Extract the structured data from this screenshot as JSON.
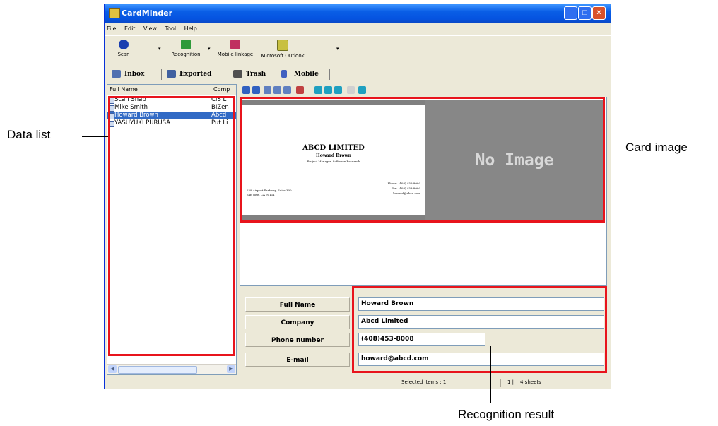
{
  "window": {
    "title": "CardMinder"
  },
  "menu": [
    "File",
    "Edit",
    "View",
    "Tool",
    "Help"
  ],
  "toolbar": {
    "scan": "Scan",
    "recognition": "Recognition",
    "mobile_linkage": "Mobile linkage",
    "outlook": "Microsoft Outlook"
  },
  "tabs": [
    "Inbox",
    "Exported",
    "Trash",
    "Mobile"
  ],
  "list": {
    "col_name": "Full Name",
    "col_company": "Comp",
    "rows": [
      {
        "name": "Scan Snap",
        "company": "CIS L"
      },
      {
        "name": "Mike Smith",
        "company": "BIZen"
      },
      {
        "name": "Howard Brown",
        "company": "Abcd"
      },
      {
        "name": "YASUYUKI PURUSA",
        "company": "Put Li"
      }
    ]
  },
  "card": {
    "company": "ABCD LIMITED",
    "name": "Howard Brown",
    "title": "Project Manager, Software Research",
    "address1": "228 Airport Parkway, Suite 300",
    "address2": "San Jose, CA 95111",
    "phone": "Phone: (408) 456-8000",
    "fax": "Fax: (408) 453-8000",
    "email": "howard@abcd.com"
  },
  "no_image": "No Image",
  "fields": [
    {
      "label": "Full Name",
      "value": "Howard Brown"
    },
    {
      "label": "Company",
      "value": "Abcd Limited"
    },
    {
      "label": "Phone number",
      "value": "(408)453-8008"
    },
    {
      "label": "E-mail",
      "value": "howard@abcd.com"
    }
  ],
  "status": {
    "selected": "Selected items : 1",
    "page": "1 |",
    "sheets": "4 sheets"
  },
  "callouts": {
    "data_list": "Data list",
    "card_image": "Card image",
    "recognition_result": "Recognition result"
  },
  "colors": {
    "highlight": "#e8141c",
    "selection": "#316ac5",
    "titlebar": "#0553e0"
  }
}
